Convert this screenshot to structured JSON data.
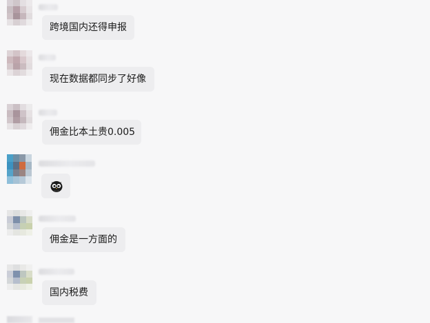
{
  "messages": [
    {
      "text": "跨境国内还得申报"
    },
    {
      "text": "现在数据都同步了好像"
    },
    {
      "text": "佣金比本土贵0.005"
    },
    {
      "text": "",
      "icon": "owl-sticker-icon"
    },
    {
      "text": "佣金是一方面的"
    },
    {
      "text": "国内税费"
    }
  ]
}
